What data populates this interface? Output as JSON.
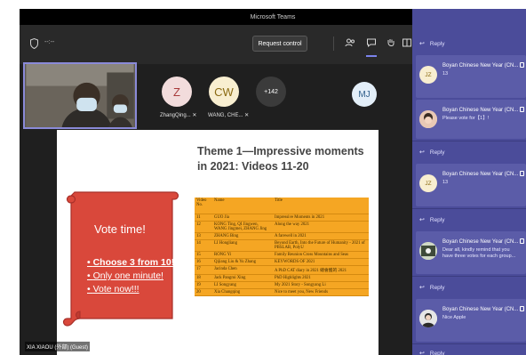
{
  "window": {
    "title": "Microsoft Teams"
  },
  "toolbar": {
    "timer": "--:--",
    "request_control_label": "Request control",
    "icons": [
      "shield-icon",
      "people-icon",
      "chat-icon",
      "hand-icon",
      "rooms-icon",
      "more-icon"
    ],
    "accent_color": "#7b83eb"
  },
  "participants": {
    "tiles": [
      {
        "initials": "Z",
        "name": "ZhangQing...",
        "bg": "#f2dcdc",
        "fg": "#a83b3b"
      },
      {
        "initials": "CW",
        "name": "WANG, CHE...",
        "bg": "#f8eed0",
        "fg": "#8a6a12"
      },
      {
        "initials": "+142",
        "name": "",
        "bg": "#3b3b3b",
        "fg": "#ffffff"
      },
      {
        "initials": "MJ",
        "name": "",
        "bg": "#e3eef8",
        "fg": "#2f5f8a"
      }
    ]
  },
  "stage": {
    "title": "Theme 1—Impressive moments in 2021: Videos 11-20",
    "vote_title": "Vote time!",
    "bullets": [
      "Choose 3 from 10!",
      "Only one minute!",
      "Vote now!!!"
    ],
    "table": {
      "headers": [
        "Video No.",
        "Name",
        "Title"
      ],
      "rows": [
        [
          "11",
          "GUO Jia",
          "Impressive Moments in 2021"
        ],
        [
          "12",
          "KONG Ting, QI Jingwen, WANG Jingmei, ZHANG Jing",
          "Along the way 2021"
        ],
        [
          "13",
          "ZHANG Bing",
          "A farewell in 2021"
        ],
        [
          "14",
          "LI Hongliang",
          "Beyond Earth, Into the Future of Humanity - 2021 of PBSLAB, PolyU"
        ],
        [
          "15",
          "RONG Yi",
          "Family Reunion Cross Mountains and Seas"
        ],
        [
          "16",
          "Qijiang Liu & Yu Zhang",
          "KEYWORDS OF 2021"
        ],
        [
          "17",
          "Jacinda Chen",
          "A PhD CAT diary in 2021 總會獲的 2021"
        ],
        [
          "18",
          "Jack Pangrui Xing",
          "PhD Highlights 2021"
        ],
        [
          "19",
          "LI Songyang",
          "My 2021 Story - Songyang Li"
        ],
        [
          "20",
          "Xia Changqing",
          "Nice to meet you, New Friends"
        ]
      ]
    },
    "presenter_name": "XIA XIAOU (外部) (Guest)",
    "banner_color": "#d9483b",
    "table_color": "#f5a623"
  },
  "chat": {
    "reply_label": "Reply",
    "messages": [
      {
        "avatar": "JZ",
        "sender": "Boyan Chinese New Year (CN...",
        "text": "13"
      },
      {
        "avatar": "",
        "sender": "Boyan Chinese New Year (CN...",
        "text": "Please vote for【1】!"
      },
      {
        "avatar": "JZ",
        "sender": "Boyan Chinese New Year (CN...",
        "text": "13"
      },
      {
        "avatar": "",
        "sender": "Boyan Chinese New Year (CN...",
        "text": "Dear all, kindly remind that you\nhave three votes for each group..."
      },
      {
        "avatar": "",
        "sender": "Boyan Chinese New Year (CN...",
        "text": "Nice Apple"
      }
    ],
    "panel_color": "#4b4c9a"
  }
}
